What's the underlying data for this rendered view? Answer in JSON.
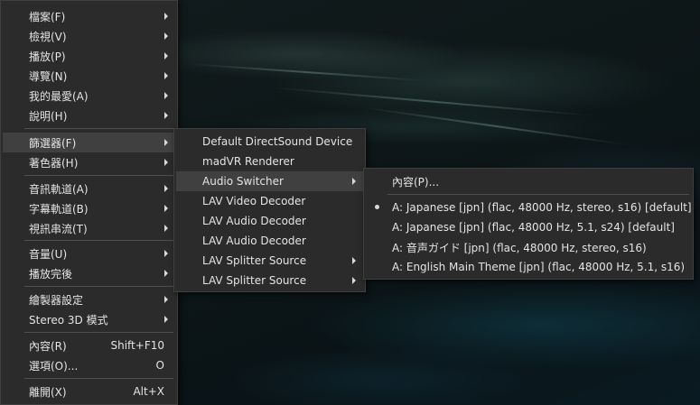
{
  "main_menu": {
    "items": [
      {
        "label": "檔案(F)",
        "shortcut": ""
      },
      {
        "label": "檢視(V)",
        "shortcut": ""
      },
      {
        "label": "播放(P)",
        "shortcut": ""
      },
      {
        "label": "導覽(N)",
        "shortcut": ""
      },
      {
        "label": "我的最愛(A)",
        "shortcut": ""
      },
      {
        "label": "說明(H)",
        "shortcut": ""
      },
      {
        "label": "篩選器(F)",
        "shortcut": ""
      },
      {
        "label": "著色器(H)",
        "shortcut": ""
      },
      {
        "label": "音訊軌道(A)",
        "shortcut": ""
      },
      {
        "label": "字幕軌道(B)",
        "shortcut": ""
      },
      {
        "label": "視訊串流(T)",
        "shortcut": ""
      },
      {
        "label": "音量(U)",
        "shortcut": ""
      },
      {
        "label": "播放完後",
        "shortcut": ""
      },
      {
        "label": "繪製器設定",
        "shortcut": ""
      },
      {
        "label": "Stereo 3D 模式",
        "shortcut": ""
      },
      {
        "label": "內容(R)",
        "shortcut": "Shift+F10"
      },
      {
        "label": "選項(O)...",
        "shortcut": "O"
      },
      {
        "label": "離開(X)",
        "shortcut": "Alt+X"
      }
    ]
  },
  "filters_menu": {
    "items": [
      {
        "label": "Default DirectSound Device"
      },
      {
        "label": "madVR Renderer"
      },
      {
        "label": "Audio Switcher"
      },
      {
        "label": "LAV Video Decoder"
      },
      {
        "label": "LAV Audio Decoder"
      },
      {
        "label": "LAV Audio Decoder"
      },
      {
        "label": "LAV Splitter Source"
      },
      {
        "label": "LAV Splitter Source"
      }
    ]
  },
  "audio_switcher_menu": {
    "properties_label": "內容(P)...",
    "tracks": [
      {
        "label": "A: Japanese [jpn] (flac, 48000 Hz, stereo, s16) [default]",
        "selected": true
      },
      {
        "label": "A: Japanese [jpn] (flac, 48000 Hz, 5.1, s24) [default]",
        "selected": false
      },
      {
        "label": "A: 音声ガイド [jpn] (flac, 48000 Hz, stereo, s16)",
        "selected": false
      },
      {
        "label": "A: English Main Theme [jpn] (flac, 48000 Hz, 5.1, s16)",
        "selected": false
      }
    ]
  }
}
